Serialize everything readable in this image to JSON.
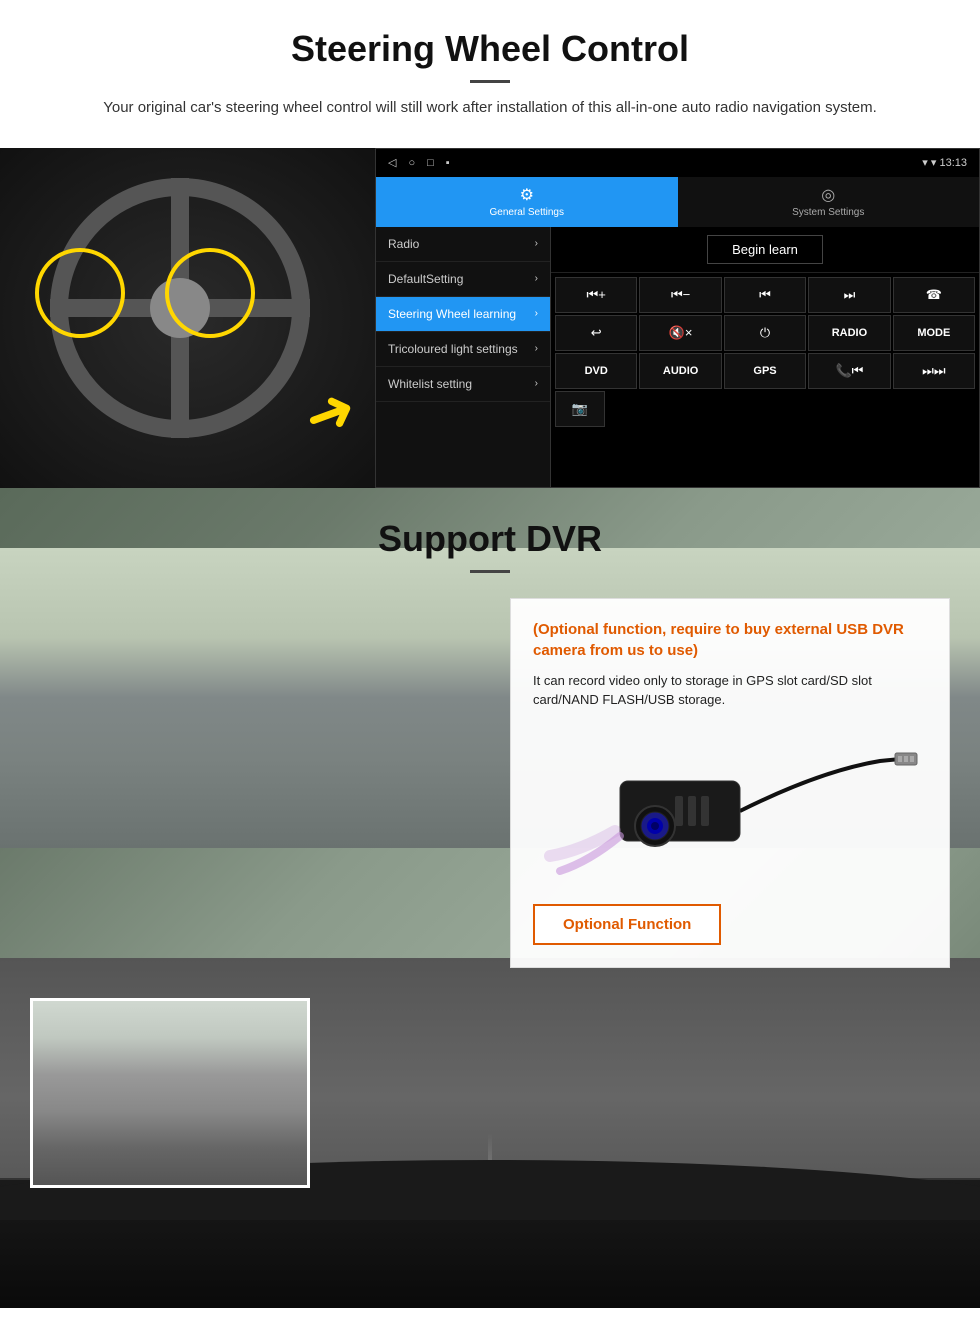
{
  "section1": {
    "title": "Steering Wheel Control",
    "subtitle": "Your original car's steering wheel control will still work after installation of this all-in-one auto radio navigation system.",
    "statusbar": {
      "nav_back": "◁",
      "nav_home": "○",
      "nav_square": "□",
      "nav_extra": "▪",
      "time": "13:13",
      "signal": "▼",
      "wifi": "▾"
    },
    "tabs": [
      {
        "id": "general",
        "icon": "⚙",
        "label": "General Settings",
        "active": true
      },
      {
        "id": "system",
        "icon": "◎",
        "label": "System Settings",
        "active": false
      }
    ],
    "menu_items": [
      {
        "id": "radio",
        "label": "Radio",
        "active": false
      },
      {
        "id": "defaultsetting",
        "label": "DefaultSetting",
        "active": false
      },
      {
        "id": "swlearning",
        "label": "Steering Wheel learning",
        "active": true
      },
      {
        "id": "tricolour",
        "label": "Tricoloured light settings",
        "active": false
      },
      {
        "id": "whitelist",
        "label": "Whitelist setting",
        "active": false
      }
    ],
    "begin_learn": "Begin learn",
    "control_buttons": [
      [
        "⏮+",
        "⏮-",
        "⏮",
        "⏭",
        "☎"
      ],
      [
        "↩",
        "🔇×",
        "⏻",
        "RADIO",
        "MODE"
      ],
      [
        "DVD",
        "AUDIO",
        "GPS",
        "📞⏮",
        "⏭⏭"
      ],
      [
        "📷"
      ]
    ]
  },
  "section2": {
    "title": "Support DVR",
    "info_title": "(Optional function, require to buy external USB DVR camera from us to use)",
    "info_text": "It can record video only to storage in GPS slot card/SD slot card/NAND FLASH/USB storage.",
    "optional_btn_label": "Optional Function"
  }
}
